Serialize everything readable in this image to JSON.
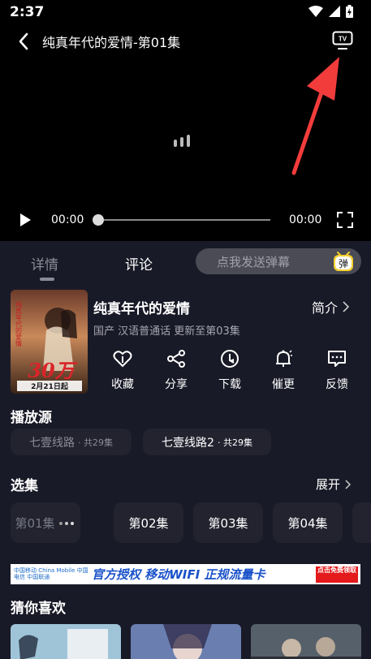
{
  "status_bar": {
    "time": "2:37"
  },
  "player": {
    "title": "纯真年代的爱情-第01集",
    "current_time": "00:00",
    "total_time": "00:00",
    "tv_icon_label": "TV"
  },
  "tabs": {
    "detail": "详情",
    "comment": "评论"
  },
  "danmu": {
    "placeholder": "点我发送弹幕",
    "button": "弹"
  },
  "show": {
    "title": "纯真年代的爱情",
    "intro_label": "简介",
    "meta": "国产 汉语普通话 更新至第03集",
    "poster": {
      "big_text": "30万",
      "date_text": "2月21日起",
      "side_text": "纯真年代的爱情"
    }
  },
  "actions": [
    {
      "label": "收藏",
      "icon": "heart-icon"
    },
    {
      "label": "分享",
      "icon": "share-icon"
    },
    {
      "label": "下载",
      "icon": "download-icon"
    },
    {
      "label": "催更",
      "icon": "bell-icon"
    },
    {
      "label": "反馈",
      "icon": "feedback-icon"
    }
  ],
  "sources": {
    "title": "播放源",
    "items": [
      {
        "name": "七壹线路",
        "count": "· 共29集"
      },
      {
        "name": "七壹线路2",
        "count": "· 共29集"
      }
    ]
  },
  "episodes": {
    "title": "选集",
    "expand_label": "展开",
    "items": [
      "第01集",
      "第02集",
      "第03集",
      "第04集"
    ]
  },
  "banner": {
    "carriers": "中国移动 China Mobile 中国电信 中国联通",
    "slogan": "官方授权 移动WIFI 正规流量卡",
    "cta": "点击免费领取"
  },
  "recommend": {
    "title": "猜你喜欢"
  },
  "colors": {
    "panel_bg": "#191a27",
    "chip_bg": "#22232f",
    "accent_red": "#e3191b"
  }
}
